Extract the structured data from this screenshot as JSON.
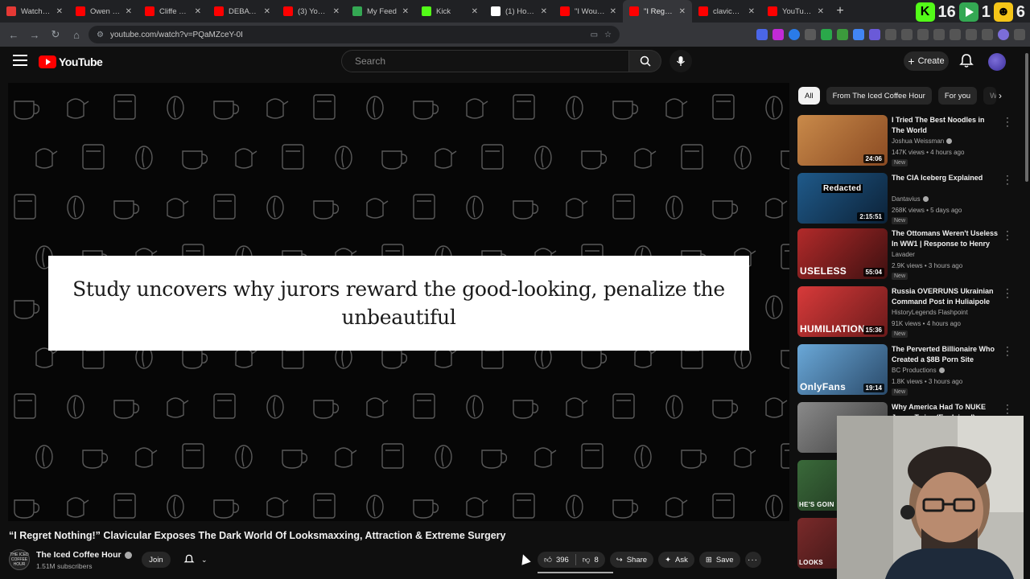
{
  "browser": {
    "tabs": [
      {
        "title": "Watch late",
        "color": "#e53935"
      },
      {
        "title": "Owen Ben",
        "color": "#ff0000"
      },
      {
        "title": "Cliffe & St",
        "color": "#ff0000"
      },
      {
        "title": "DEBATE! W",
        "color": "#ff0000"
      },
      {
        "title": "(3) YouTub",
        "color": "#ff0000"
      },
      {
        "title": "My Feed",
        "color": "#34a853"
      },
      {
        "title": "Kick",
        "color": "#53fc18"
      },
      {
        "title": "(1) Home",
        "color": "#ffffff"
      },
      {
        "title": "\"I Would H",
        "color": "#ff0000"
      },
      {
        "title": "\"I Regret N",
        "color": "#ff0000",
        "active": true
      },
      {
        "title": "clavicular",
        "color": "#ff0000"
      },
      {
        "title": "YouTube H",
        "color": "#ff0000"
      }
    ],
    "new_tab": "+",
    "url": "youtube.com/watch?v=PQaMZceY-0I"
  },
  "overlay": {
    "numbers": [
      "16",
      "1",
      "6"
    ]
  },
  "youtube": {
    "logo_text": "YouTube",
    "search_placeholder": "Search",
    "create_label": "Create"
  },
  "video": {
    "caption": "Study uncovers why jurors reward the good-looking, penalize the unbeautiful",
    "title": "“I Regret Nothing!” Clavicular Exposes The Dark World Of Looksmaxxing, Attraction & Extreme Surgery",
    "channel_name": "The Iced Coffee Hour",
    "channel_avatar_text": "THE ICED COFFEE HOUR",
    "subscribers": "1.51M subscribers",
    "join_label": "Join",
    "likes": "396",
    "dislikes": "8",
    "share_label": "Share",
    "ask_label": "Ask",
    "save_label": "Save"
  },
  "sidebar": {
    "chips": [
      "All",
      "From The Iced Coffee Hour",
      "For you",
      "W"
    ],
    "recommendations": [
      {
        "title": "I Tried The Best Noodles in The World",
        "channel": "Joshua Weissman",
        "verified": true,
        "meta": "147K views • 4 hours ago",
        "new": "New",
        "duration": "24:06",
        "thumb": [
          "#c98a4a",
          "#8a4a22"
        ],
        "tag": ""
      },
      {
        "title": "The CIA Iceberg Explained",
        "channel": "Dantavius",
        "verified": true,
        "meta": "268K views • 5 days ago",
        "new": "New",
        "duration": "2:15:51",
        "thumb": [
          "#1f5a8a",
          "#0c2238"
        ],
        "tag": "Redacted"
      },
      {
        "title": "The Ottomans Weren't Useless In WW1 | Response to Henry ...",
        "channel": "Lavader",
        "verified": false,
        "meta": "2.9K views • 3 hours ago",
        "new": "New",
        "duration": "55:04",
        "thumb": [
          "#b22a2a",
          "#3d1010"
        ],
        "tag": "USELESS"
      },
      {
        "title": "Russia OVERRUNS Ukrainian Command Post in Huliaipole",
        "channel": "HistoryLegends Flashpoint",
        "verified": false,
        "meta": "91K views • 4 hours ago",
        "new": "New",
        "duration": "15:36",
        "thumb": [
          "#d83a3a",
          "#6a1a1a"
        ],
        "tag": "HUMILIATION"
      },
      {
        "title": "The Perverted Billionaire Who Created a $8B Porn Site",
        "channel": "BC Productions",
        "verified": true,
        "meta": "1.8K views • 3 hours ago",
        "new": "New",
        "duration": "19:14",
        "thumb": [
          "#6aa8d8",
          "#2a4a6a"
        ],
        "tag": "OnlyFans"
      },
      {
        "title": "Why America Had To NUKE Japan Twice (Explained)",
        "channel": "",
        "verified": false,
        "meta": "",
        "new": "",
        "duration": "",
        "thumb": [
          "#8a8a8a",
          "#3a3a3a"
        ],
        "tag": ""
      },
      {
        "title": "",
        "channel": "",
        "verified": false,
        "meta": "",
        "new": "",
        "duration": "",
        "thumb": [
          "#3a6a3a",
          "#1a2a1a"
        ],
        "tag": "HE'S GOIN"
      },
      {
        "title": "",
        "channel": "",
        "verified": false,
        "meta": "",
        "new": "",
        "duration": "",
        "thumb": [
          "#7a2a2a",
          "#2a1010"
        ],
        "tag": "LOOKS"
      }
    ]
  },
  "colors": {
    "background": "#0f0f0f",
    "youtube_red": "#ff0000",
    "chip_bg": "#272727"
  }
}
